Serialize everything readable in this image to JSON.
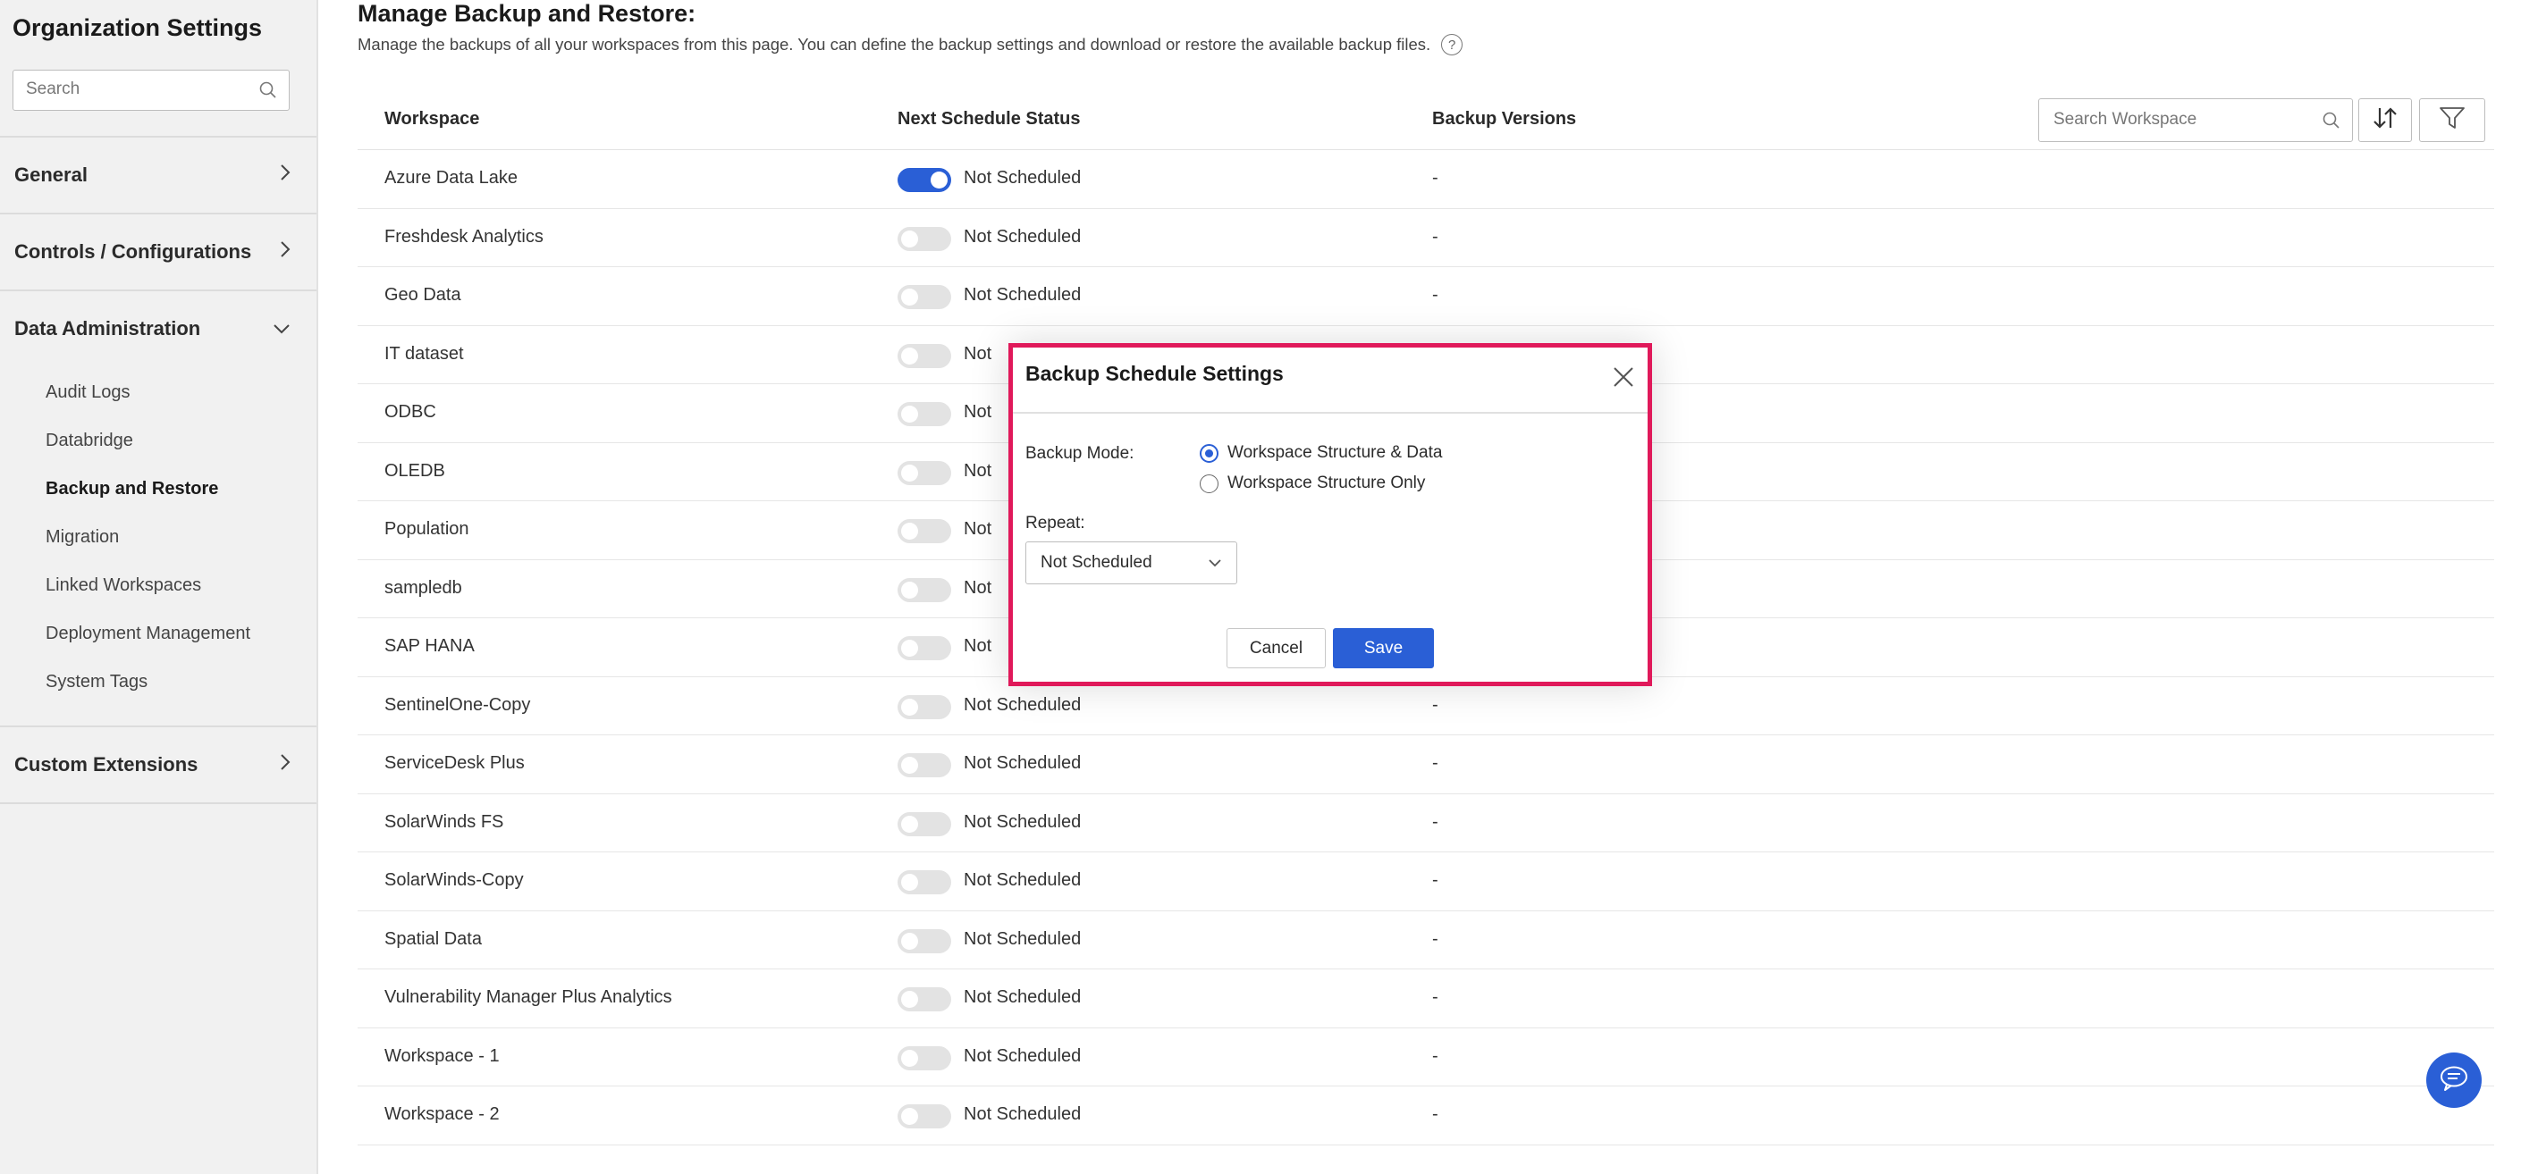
{
  "sidebar": {
    "title": "Organization Settings",
    "search_placeholder": "Search",
    "sections": {
      "general": "General",
      "controls": "Controls / Configurations",
      "data_admin": "Data Administration",
      "custom_ext": "Custom Extensions"
    },
    "data_admin_items": [
      "Audit Logs",
      "Databridge",
      "Backup and Restore",
      "Migration",
      "Linked Workspaces",
      "Deployment Management",
      "System Tags"
    ],
    "active_item": "Backup and Restore"
  },
  "page": {
    "title": "Manage Backup and Restore:",
    "description": "Manage the backups of all your workspaces from this page. You can define the backup settings and download or restore the available backup files."
  },
  "table": {
    "headers": {
      "workspace": "Workspace",
      "status": "Next Schedule Status",
      "versions": "Backup Versions"
    },
    "search_placeholder": "Search Workspace",
    "rows": [
      {
        "workspace": "Azure Data Lake",
        "toggle_on": true,
        "status": "Not Scheduled",
        "versions": "-"
      },
      {
        "workspace": "Freshdesk Analytics",
        "toggle_on": false,
        "status": "Not Scheduled",
        "versions": "-"
      },
      {
        "workspace": "Geo Data",
        "toggle_on": false,
        "status": "Not Scheduled",
        "versions": "-"
      },
      {
        "workspace": "IT dataset",
        "toggle_on": false,
        "status": "Not",
        "versions": ""
      },
      {
        "workspace": "ODBC",
        "toggle_on": false,
        "status": "Not",
        "versions": ""
      },
      {
        "workspace": "OLEDB",
        "toggle_on": false,
        "status": "Not",
        "versions": ""
      },
      {
        "workspace": "Population",
        "toggle_on": false,
        "status": "Not",
        "versions": ""
      },
      {
        "workspace": "sampledb",
        "toggle_on": false,
        "status": "Not",
        "versions": ""
      },
      {
        "workspace": "SAP HANA",
        "toggle_on": false,
        "status": "Not",
        "versions": ""
      },
      {
        "workspace": "SentinelOne-Copy",
        "toggle_on": false,
        "status": "Not Scheduled",
        "versions": "-"
      },
      {
        "workspace": "ServiceDesk Plus",
        "toggle_on": false,
        "status": "Not Scheduled",
        "versions": "-"
      },
      {
        "workspace": "SolarWinds FS",
        "toggle_on": false,
        "status": "Not Scheduled",
        "versions": "-"
      },
      {
        "workspace": "SolarWinds-Copy",
        "toggle_on": false,
        "status": "Not Scheduled",
        "versions": "-"
      },
      {
        "workspace": "Spatial Data",
        "toggle_on": false,
        "status": "Not Scheduled",
        "versions": "-"
      },
      {
        "workspace": "Vulnerability Manager Plus Analytics",
        "toggle_on": false,
        "status": "Not Scheduled",
        "versions": "-"
      },
      {
        "workspace": "Workspace - 1",
        "toggle_on": false,
        "status": "Not Scheduled",
        "versions": "-"
      },
      {
        "workspace": "Workspace - 2",
        "toggle_on": false,
        "status": "Not Scheduled",
        "versions": "-"
      }
    ]
  },
  "modal": {
    "title": "Backup Schedule Settings",
    "backup_mode_label": "Backup Mode:",
    "options": [
      "Workspace Structure & Data",
      "Workspace Structure Only"
    ],
    "selected_option": "Workspace Structure & Data",
    "repeat_label": "Repeat:",
    "repeat_value": "Not Scheduled",
    "cancel": "Cancel",
    "save": "Save"
  },
  "colors": {
    "accent": "#2a5fd6",
    "highlight": "#e0195a"
  }
}
